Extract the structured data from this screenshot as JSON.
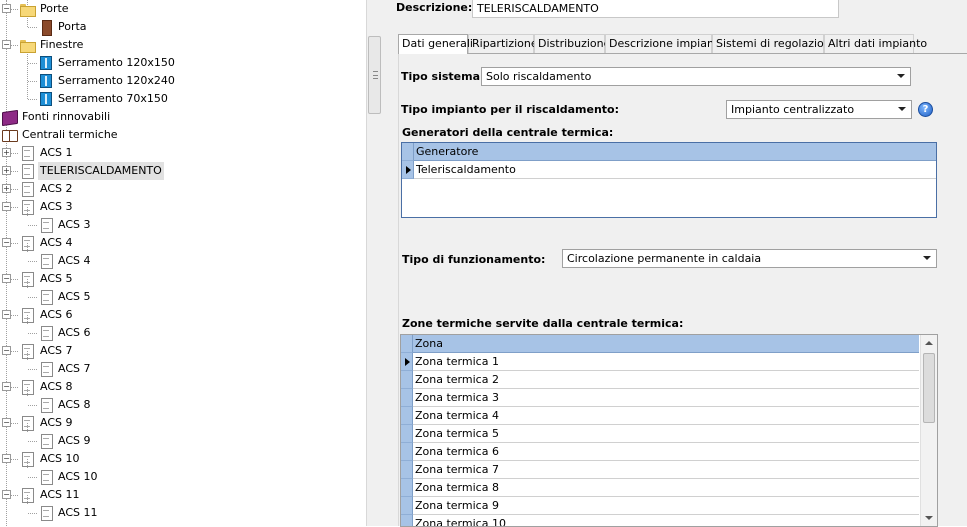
{
  "tree": {
    "items": [
      {
        "label": "Porte",
        "icon": "folder-icon"
      },
      {
        "label": "Porta",
        "icon": "door-icon"
      },
      {
        "label": "Finestre",
        "icon": "folder-icon"
      },
      {
        "label": "Serramento 120x150",
        "icon": "window-icon"
      },
      {
        "label": "Serramento 120x240",
        "icon": "window-icon"
      },
      {
        "label": "Serramento 70x150",
        "icon": "window-icon"
      },
      {
        "label": "Fonti rinnovabili",
        "icon": "book-icon"
      },
      {
        "label": "Centrali termiche",
        "icon": "open-book-icon"
      },
      {
        "label": "ACS 1",
        "icon": "document-icon"
      },
      {
        "label": "TELERISCALDAMENTO",
        "icon": "document-icon"
      },
      {
        "label": "ACS 2",
        "icon": "document-icon"
      },
      {
        "label": "ACS 3",
        "icon": "document-icon"
      },
      {
        "label": "ACS 3",
        "icon": "document-icon"
      },
      {
        "label": "ACS 4",
        "icon": "document-icon"
      },
      {
        "label": "ACS 4",
        "icon": "document-icon"
      },
      {
        "label": "ACS 5",
        "icon": "document-icon"
      },
      {
        "label": "ACS 5",
        "icon": "document-icon"
      },
      {
        "label": "ACS 6",
        "icon": "document-icon"
      },
      {
        "label": "ACS 6",
        "icon": "document-icon"
      },
      {
        "label": "ACS 7",
        "icon": "document-icon"
      },
      {
        "label": "ACS 7",
        "icon": "document-icon"
      },
      {
        "label": "ACS 8",
        "icon": "document-icon"
      },
      {
        "label": "ACS 8",
        "icon": "document-icon"
      },
      {
        "label": "ACS 9",
        "icon": "document-icon"
      },
      {
        "label": "ACS 9",
        "icon": "document-icon"
      },
      {
        "label": "ACS 10",
        "icon": "document-icon"
      },
      {
        "label": "ACS 10",
        "icon": "document-icon"
      },
      {
        "label": "ACS 11",
        "icon": "document-icon"
      },
      {
        "label": "ACS 11",
        "icon": "document-icon"
      }
    ],
    "selected": "TELERISCALDAMENTO"
  },
  "form": {
    "descrizione_label": "Descrizione:",
    "descrizione_value": "TELERISCALDAMENTO"
  },
  "tabs": [
    {
      "label": "Dati generali",
      "active": true
    },
    {
      "label": "Ripartizione"
    },
    {
      "label": "Distribuzione"
    },
    {
      "label": "Descrizione impianto"
    },
    {
      "label": "Sistemi di regolazione"
    },
    {
      "label": "Altri dati impianto"
    }
  ],
  "general": {
    "tipo_sistema_label": "Tipo sistema:",
    "tipo_sistema_value": "Solo riscaldamento",
    "tipo_impianto_label": "Tipo impianto per il riscaldamento:",
    "tipo_impianto_value": "Impianto centralizzato",
    "generatori_label": "Generatori della centrale termica:",
    "generatori_header": "Generatore",
    "generatori_rows": [
      "Teleriscaldamento"
    ],
    "tipo_funzionamento_label": "Tipo di funzionamento:",
    "tipo_funzionamento_value": "Circolazione permanente in caldaia",
    "zone_label": "Zone termiche servite dalla centrale termica:",
    "zone_header": "Zona",
    "zone_rows": [
      "Zona termica 1",
      "Zona termica 2",
      "Zona termica 3",
      "Zona termica 4",
      "Zona termica 5",
      "Zona termica 6",
      "Zona termica 7",
      "Zona termica 8",
      "Zona termica 9",
      "Zona termica 10"
    ]
  },
  "colors": {
    "grid_header": "#a7c3e6",
    "grid_border": "#4a6fa5",
    "panel_bg": "#f0f0f0",
    "selection_bg": "#e1e1e1"
  }
}
